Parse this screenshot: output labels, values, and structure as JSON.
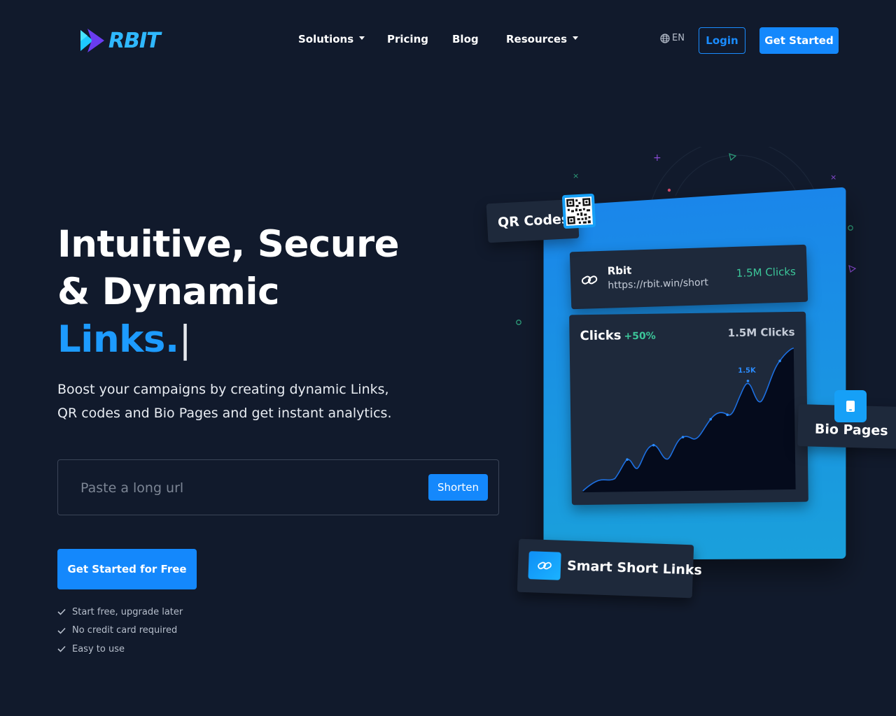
{
  "brand": {
    "name": "RBIT"
  },
  "nav": {
    "items": [
      {
        "label": "Solutions",
        "has_dropdown": true
      },
      {
        "label": "Pricing",
        "has_dropdown": false
      },
      {
        "label": "Blog",
        "has_dropdown": false
      },
      {
        "label": "Resources",
        "has_dropdown": true
      }
    ],
    "language": "EN",
    "login_label": "Login",
    "get_started_label": "Get Started"
  },
  "hero": {
    "headline_line1": "Intuitive, Secure",
    "headline_line2": "& Dynamic",
    "headline_accent": "Links.",
    "cursor": "|",
    "subtext": "Boost your campaigns by creating dynamic Links, QR codes and Bio Pages and get instant analytics.",
    "url_placeholder": "Paste a long url",
    "shorten_label": "Shorten",
    "cta_label": "Get Started for Free",
    "checks": [
      "Start free, upgrade later",
      "No credit card required",
      "Easy to use"
    ]
  },
  "illustration": {
    "qr_label": "QR Codes",
    "link_card": {
      "title": "Rbit",
      "url": "https://rbit.win/short",
      "clicks": "1.5M Clicks"
    },
    "chart_card": {
      "title": "Clicks",
      "growth": "+50%",
      "clicks": "1.5M Clicks",
      "peak_label": "1.5K"
    },
    "bio_label": "Bio Pages",
    "smart_label": "Smart Short Links"
  },
  "colors": {
    "background": "#111a2c",
    "accent": "#1488fc",
    "accent_text": "#1d9bff",
    "positive": "#3cc79a",
    "card": "#1e293b"
  }
}
